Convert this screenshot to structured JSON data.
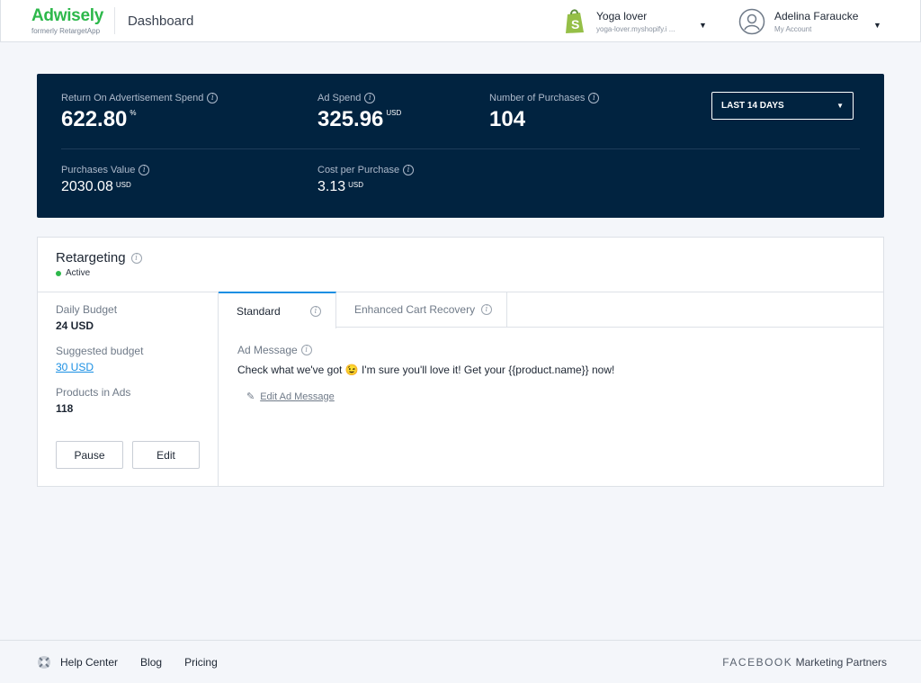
{
  "header": {
    "brand": "Adwisely",
    "brand_sub": "formerly RetargetApp",
    "page": "Dashboard",
    "store": {
      "name": "Yoga lover",
      "url": "yoga-lover.myshopify.i ..."
    },
    "account": {
      "name": "Adelina Faraucke",
      "sub": "My Account"
    }
  },
  "metrics": [
    {
      "label": "Return On Advertisement Spend",
      "value": "622.80",
      "unit": "%"
    },
    {
      "label": "Ad Spend",
      "value": "325.96",
      "unit": "USD"
    },
    {
      "label": "Number of Purchases",
      "value": "104",
      "unit": ""
    },
    {
      "label": "Purchases Value",
      "value": "2030.08",
      "unit": "USD"
    },
    {
      "label": "Cost per Purchase",
      "value": "3.13",
      "unit": "USD"
    }
  ],
  "period": "LAST 14 DAYS",
  "campaign": {
    "title": "Retargeting",
    "status": "Active",
    "status_color": "#2db84b",
    "fields": [
      {
        "label": "Daily Budget",
        "value": "24 USD"
      },
      {
        "label": "Suggested budget",
        "value": "30 USD"
      },
      {
        "label": "Products in Ads",
        "value": "118"
      }
    ],
    "pause": "Pause",
    "edit": "Edit",
    "tabs": [
      "Standard",
      "Enhanced Cart Recovery"
    ],
    "ad_message_label": "Ad Message",
    "ad_message": "Check what we've got 😉 I'm sure you'll love it! Get your {{product.name}} now!",
    "edit_message": "Edit Ad Message"
  },
  "footer": {
    "links": [
      "Help Center",
      "Blog",
      "Pricing"
    ],
    "partner_brand": "FACEBOOK",
    "partner_text": "Marketing Partners"
  }
}
